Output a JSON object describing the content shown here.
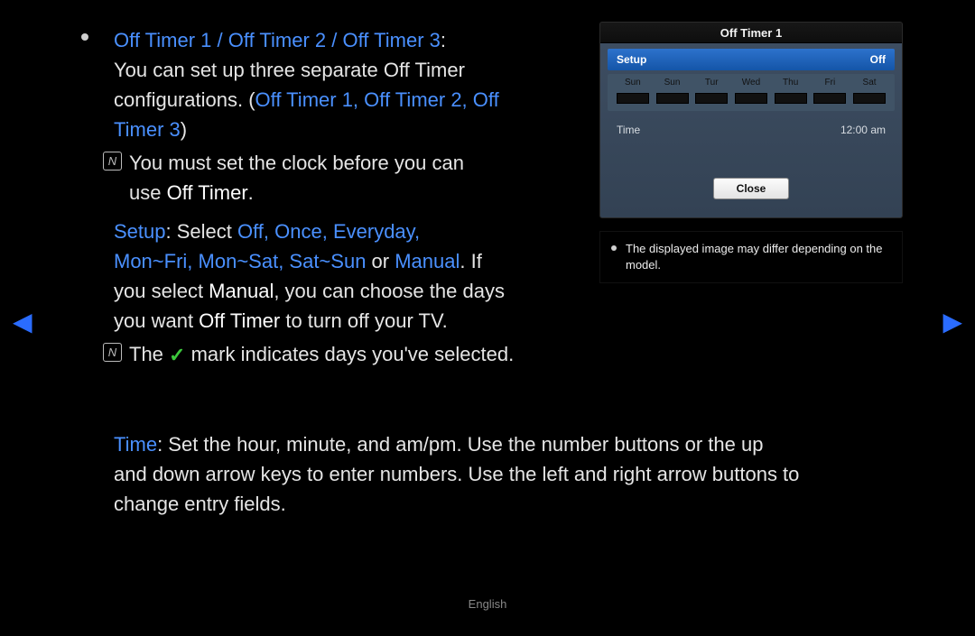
{
  "bullet_title": "Off Timer 1 / Off Timer 2 / Off Timer 3",
  "line1_a": "You can set up three separate Off Timer",
  "line2_a": "configurations. (",
  "line2_bold": "Off Timer 1, Off Timer 2, Off",
  "line3_bold": "Timer 3",
  "line3_close": ")",
  "note1_a": "You must set the clock before you can",
  "note1_b": "use ",
  "note1_bold": "Off Timer",
  "note1_c": ".",
  "setup_label": "Setup",
  "setup_sep": ": Select ",
  "setup_vals": "Off, Once, Everyday,",
  "setup_line2_blue": "Mon~Fri, Mon~Sat, Sat~Sun",
  "setup_line2_mid": " or ",
  "setup_line2_manual": "Manual",
  "setup_line2_end": ". If",
  "setup_line3_a": "you select ",
  "setup_line3_bold": "Manual",
  "setup_line3_b": ", you can choose the days",
  "setup_line4_a": "you want ",
  "setup_line4_bold": "Off Timer",
  "setup_line4_b": " to turn off your TV.",
  "note2_a": "The ",
  "note2_b": " mark indicates days you've selected.",
  "time_label": "Time",
  "time_body1": ": Set the hour, minute, and am/pm. Use the number buttons or the up",
  "time_body2": "and down arrow keys to enter numbers. Use the left and right arrow buttons to",
  "time_body3": "change entry fields.",
  "panel": {
    "title": "Off Timer 1",
    "setup_label": "Setup",
    "setup_value": "Off",
    "days": [
      "Sun",
      "Sun",
      "Tur",
      "Wed",
      "Thu",
      "Fri",
      "Sat"
    ],
    "time_label": "Time",
    "time_value": "12:00 am",
    "close": "Close",
    "caption": "The displayed image may differ depending on the model."
  },
  "nav_left": "◀",
  "nav_right": "▶",
  "footer": "English"
}
